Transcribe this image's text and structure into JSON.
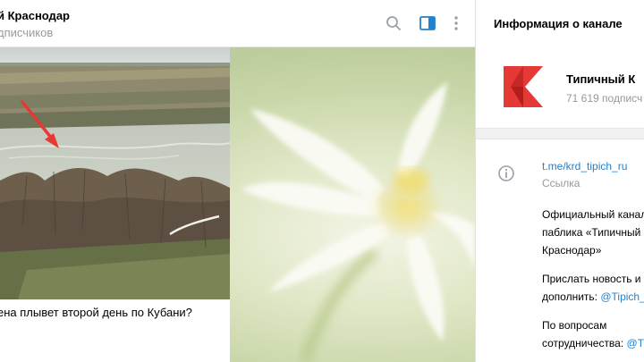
{
  "chat": {
    "title": "й Краснодар",
    "subtitle": "дписчиков",
    "caption": "ена плывет второй день по Кубани?"
  },
  "icons": {
    "search": "search-icon",
    "sidepanel": "side-panel-icon",
    "more": "more-vertical-icon",
    "info": "info-icon"
  },
  "info_panel": {
    "title": "Информация о канале",
    "channel_name": "Типичный К",
    "subscribers": "71 619 подписч",
    "link": "t.me/krd_tipich_ru",
    "link_label": "Ссылка",
    "description": {
      "line1": "Официальный канал",
      "line2": "паблика «Типичный",
      "line3": "Краснодар»",
      "line4": "Прислать новость и",
      "line5_text": "дополнить: ",
      "line5_mention": "@Tipich_",
      "line6": "По вопросам",
      "line7_text": "сотрудничества: ",
      "line7_mention": "@Ti"
    }
  },
  "colors": {
    "accent": "#2481cc",
    "logo_red": "#e53935",
    "muted_text": "#999999"
  }
}
